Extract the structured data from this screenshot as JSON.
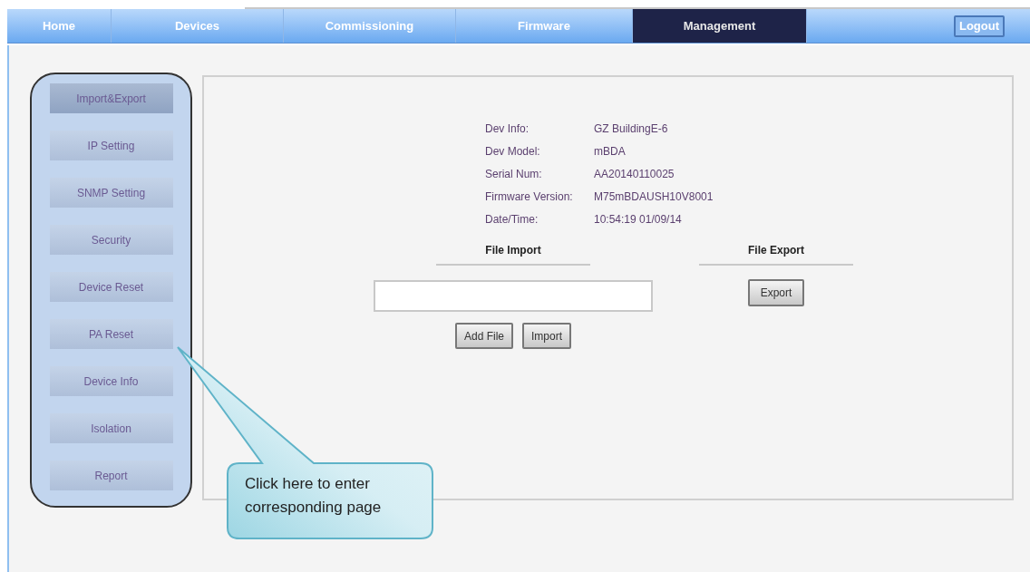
{
  "nav": {
    "tabs": [
      {
        "label": "Home",
        "selected": false
      },
      {
        "label": "Devices",
        "selected": false
      },
      {
        "label": "Commissioning",
        "selected": false
      },
      {
        "label": "Firmware",
        "selected": false
      },
      {
        "label": "Management",
        "selected": true
      }
    ],
    "logout": "Logout"
  },
  "sidebar": {
    "items": [
      {
        "label": "Import&Export",
        "selected": true
      },
      {
        "label": "IP Setting",
        "selected": false
      },
      {
        "label": "SNMP Setting",
        "selected": false
      },
      {
        "label": "Security",
        "selected": false
      },
      {
        "label": "Device Reset",
        "selected": false
      },
      {
        "label": "PA Reset",
        "selected": false
      },
      {
        "label": "Device Info",
        "selected": false
      },
      {
        "label": "Isolation",
        "selected": false
      },
      {
        "label": "Report",
        "selected": false
      }
    ]
  },
  "info": [
    {
      "label": "Dev Info:",
      "value": "GZ BuildingE-6"
    },
    {
      "label": "Dev Model:",
      "value": "mBDA"
    },
    {
      "label": "Serial Num:",
      "value": "AA20140110025"
    },
    {
      "label": "Firmware Version:",
      "value": "M75mBDAUSH10V8001"
    },
    {
      "label": "Date/Time:",
      "value": "10:54:19 01/09/14"
    }
  ],
  "file_import": {
    "heading": "File Import",
    "buttons": [
      "Add File",
      "Import"
    ]
  },
  "file_export": {
    "heading": "File Export",
    "button": "Export"
  },
  "callout": "Click here to enter corresponding page"
}
